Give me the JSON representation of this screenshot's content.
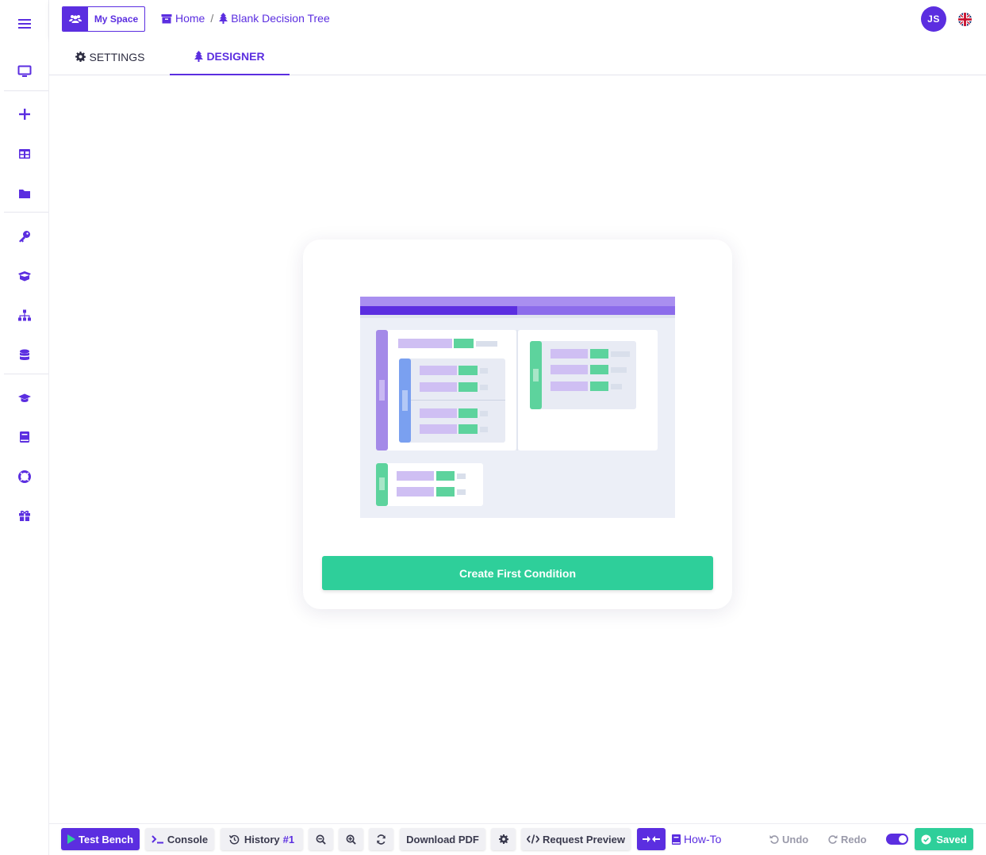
{
  "colors": {
    "accent": "#5b2ee0",
    "success": "#2ecf9a"
  },
  "sidebar": {
    "items": [
      {
        "icon": "menu-icon"
      },
      {
        "icon": "monitor-icon"
      },
      {
        "icon": "plus-icon"
      },
      {
        "icon": "table-icon"
      },
      {
        "icon": "folder-icon"
      },
      {
        "icon": "key-icon"
      },
      {
        "icon": "box-icon"
      },
      {
        "icon": "sitemap-icon"
      },
      {
        "icon": "database-icon"
      },
      {
        "icon": "graduation-cap-icon"
      },
      {
        "icon": "book-icon"
      },
      {
        "icon": "life-ring-icon"
      },
      {
        "icon": "gift-icon"
      }
    ]
  },
  "header": {
    "workspace_label": "My Space",
    "breadcrumbs": [
      "Home",
      "Blank Decision Tree"
    ],
    "breadcrumb_separator": "/",
    "avatar_initials": "JS",
    "language_icon": "uk-flag-icon"
  },
  "tabs": [
    {
      "label": "SETTINGS",
      "icon": "gear-icon",
      "active": false
    },
    {
      "label": "DESIGNER",
      "icon": "tree-icon",
      "active": true
    }
  ],
  "main": {
    "empty_state_button": "Create First Condition"
  },
  "bottom_bar": {
    "test_bench": "Test Bench",
    "console": "Console",
    "history_label": "History",
    "history_count": "#1",
    "download_pdf": "Download PDF",
    "request_preview": "Request Preview",
    "how_to": "How-To",
    "undo": "Undo",
    "redo": "Redo",
    "saved": "Saved",
    "toggle_on": true
  }
}
